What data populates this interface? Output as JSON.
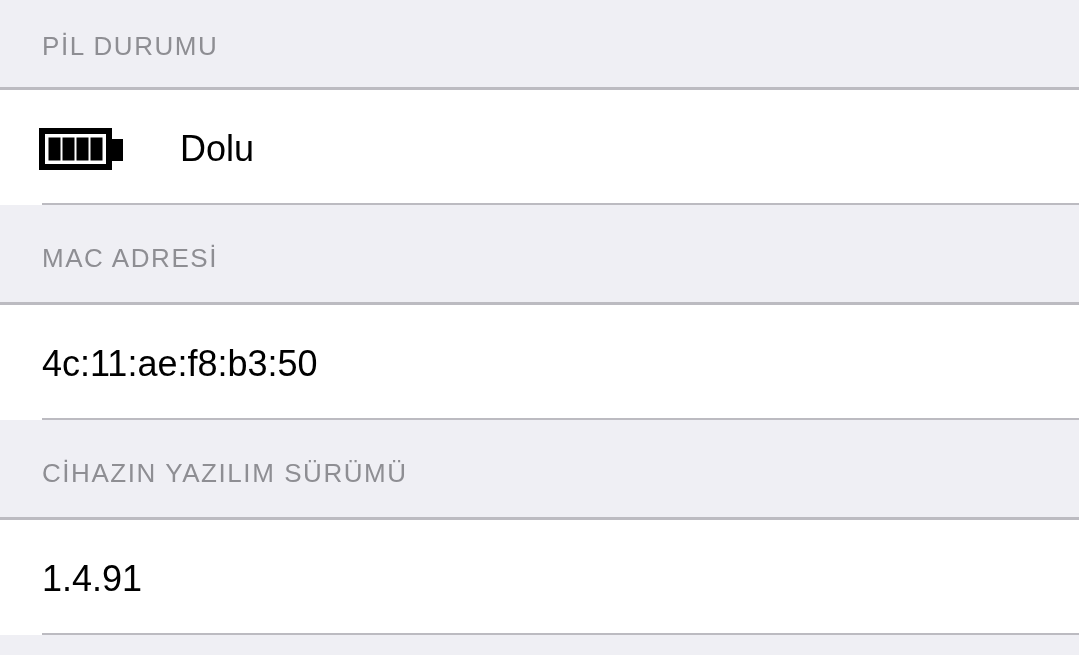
{
  "sections": [
    {
      "header": "PİL DURUMU",
      "kind": "battery",
      "value": "Dolu"
    },
    {
      "header": "MAC ADRESİ",
      "kind": "text",
      "value": "4c:11:ae:f8:b3:50"
    },
    {
      "header": "CİHAZIN YAZILIM SÜRÜMÜ",
      "kind": "text",
      "value": "1.4.91"
    }
  ]
}
